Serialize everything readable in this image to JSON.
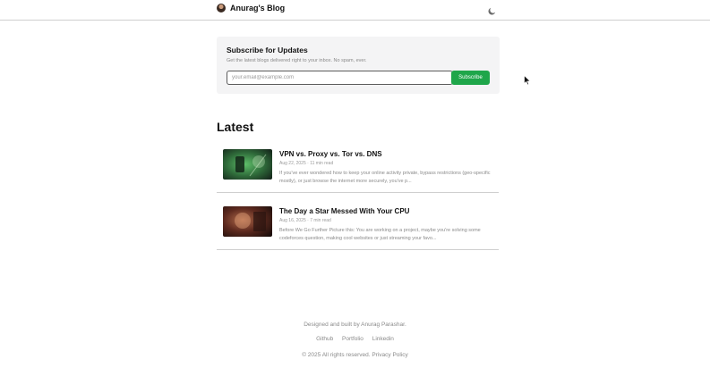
{
  "header": {
    "brand_name": "Anurag's Blog",
    "theme_icon": "moon-icon"
  },
  "subscribe": {
    "title": "Subscribe for Updates",
    "description": "Get the latest blogs delivered right to your inbox. No spam, ever.",
    "email_placeholder": "your.email@example.com",
    "button_label": "Subscribe",
    "button_color": "#1fa64a"
  },
  "latest": {
    "heading": "Latest",
    "posts": [
      {
        "title": "VPN vs. Proxy vs. Tor vs. DNS",
        "date": "Aug 22, 2025",
        "read_time": "11 min read",
        "excerpt": "If you've ever wondered how to keep your online activity private, bypass restrictions (geo-specific mostly), or just browse the internet more securely, you've p..."
      },
      {
        "title": "The Day a Star Messed With Your CPU",
        "date": "Aug 16, 2025",
        "read_time": "7 min read",
        "excerpt": "Before We Go Further Picture this: You are working on a project, maybe you're solving some codeforces question, making cool websites or just streaming your favo..."
      }
    ]
  },
  "footer": {
    "credit": "Designed and built by Anurag Parashar.",
    "links": [
      "Github",
      "Portfolio",
      "Linkedin"
    ],
    "copyright": "© 2025 All rights reserved.",
    "policy_label": "Privacy Policy"
  }
}
